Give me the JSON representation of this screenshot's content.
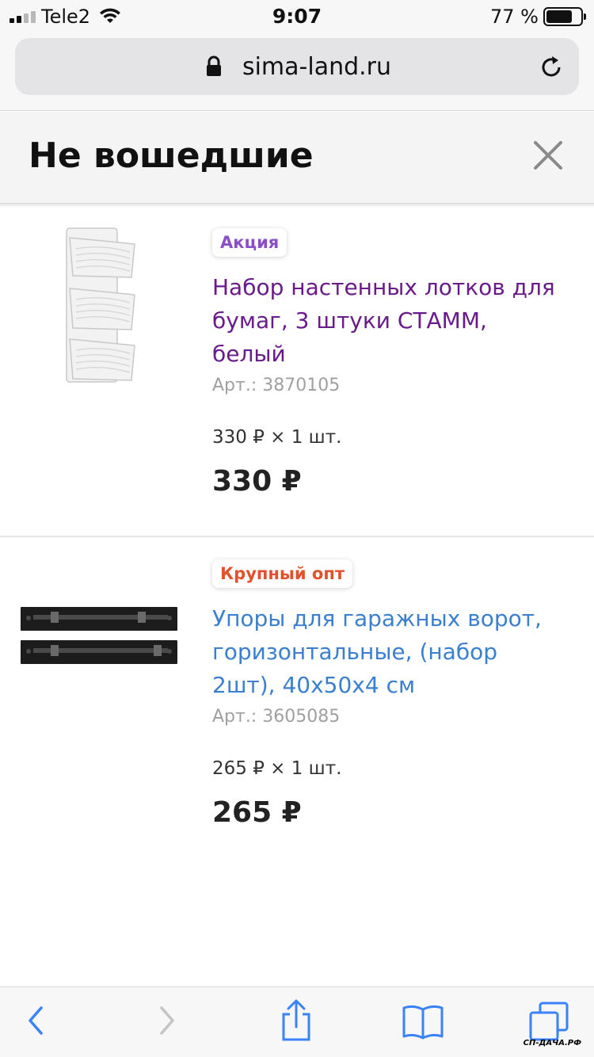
{
  "status_bar": {
    "carrier": "Tele2",
    "time": "9:07",
    "battery": "77 %",
    "battery_level": 0.77
  },
  "browser": {
    "url": "sima-land.ru"
  },
  "panel": {
    "title": "Не вошедшие"
  },
  "products": [
    {
      "badge": "Акция",
      "name": "Набор настенных лотков для бумаг, 3 штуки СТАММ, белый",
      "sku": "Арт.: 3870105",
      "qty_line": "330 ₽ × 1 шт.",
      "total": "330 ₽"
    },
    {
      "badge": "Крупный опт",
      "name": "Упоры для гаражных ворот, горизонтальные, (набор 2шт), 40х50х4 см",
      "sku": "Арт.: 3605085",
      "qty_line": "265 ₽ × 1 шт.",
      "total": "265 ₽"
    }
  ],
  "watermark": "СП-ДАЧА.РФ",
  "colors": {
    "badge_promo": "#8a4fc8",
    "badge_wholesale": "#e3502a",
    "visited_link": "#6a1b8a",
    "link": "#3a7fd0",
    "ios_blue": "#3a82f7"
  }
}
